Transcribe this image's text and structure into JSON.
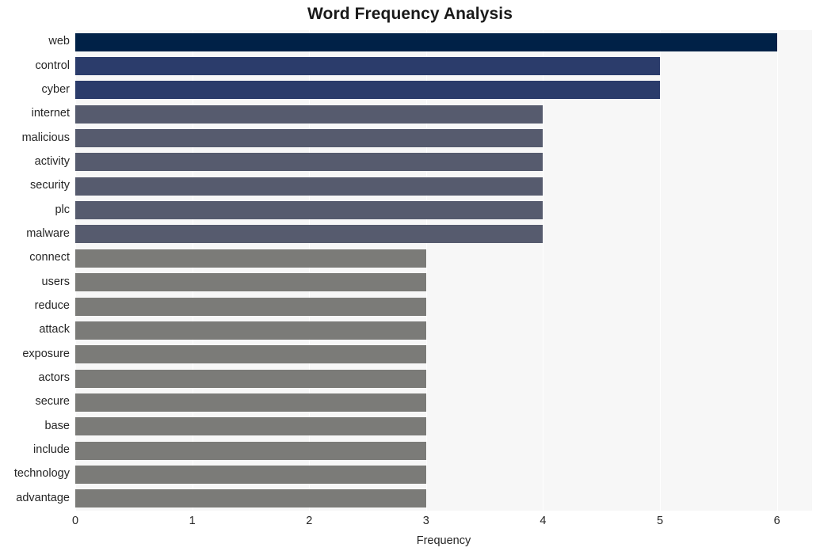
{
  "chart_data": {
    "type": "bar",
    "orientation": "horizontal",
    "title": "Word Frequency Analysis",
    "xlabel": "Frequency",
    "ylabel": "",
    "xlim": [
      0,
      6.3
    ],
    "xticks": [
      0,
      1,
      2,
      3,
      4,
      5,
      6
    ],
    "xtick_labels": [
      "0",
      "1",
      "2",
      "3",
      "4",
      "5",
      "6"
    ],
    "grid": true,
    "grid_axis": "x",
    "legend": false,
    "plot_background": "#f7f7f7",
    "figure_background": "#ffffff",
    "categories": [
      "web",
      "control",
      "cyber",
      "internet",
      "malicious",
      "activity",
      "security",
      "plc",
      "malware",
      "connect",
      "users",
      "reduce",
      "attack",
      "exposure",
      "actors",
      "secure",
      "base",
      "include",
      "technology",
      "advantage"
    ],
    "values": [
      6,
      5,
      5,
      4,
      4,
      4,
      4,
      4,
      4,
      3,
      3,
      3,
      3,
      3,
      3,
      3,
      3,
      3,
      3
    ],
    "bars": [
      {
        "label": "web",
        "value": 6,
        "color": "#002147"
      },
      {
        "label": "control",
        "value": 5,
        "color": "#2b3c6b"
      },
      {
        "label": "cyber",
        "value": 5,
        "color": "#2b3c6b"
      },
      {
        "label": "internet",
        "value": 4,
        "color": "#565b6e"
      },
      {
        "label": "malicious",
        "value": 4,
        "color": "#565b6e"
      },
      {
        "label": "activity",
        "value": 4,
        "color": "#565b6e"
      },
      {
        "label": "security",
        "value": 4,
        "color": "#565b6e"
      },
      {
        "label": "plc",
        "value": 4,
        "color": "#565b6e"
      },
      {
        "label": "malware",
        "value": 4,
        "color": "#565b6e"
      },
      {
        "label": "connect",
        "value": 3,
        "color": "#7b7b78"
      },
      {
        "label": "users",
        "value": 3,
        "color": "#7b7b78"
      },
      {
        "label": "reduce",
        "value": 3,
        "color": "#7b7b78"
      },
      {
        "label": "attack",
        "value": 3,
        "color": "#7b7b78"
      },
      {
        "label": "exposure",
        "value": 3,
        "color": "#7b7b78"
      },
      {
        "label": "actors",
        "value": 3,
        "color": "#7b7b78"
      },
      {
        "label": "secure",
        "value": 3,
        "color": "#7b7b78"
      },
      {
        "label": "base",
        "value": 3,
        "color": "#7b7b78"
      },
      {
        "label": "include",
        "value": 3,
        "color": "#7b7b78"
      },
      {
        "label": "technology",
        "value": 3,
        "color": "#7b7b78"
      },
      {
        "label": "advantage",
        "value": 3,
        "color": "#7b7b78"
      }
    ]
  }
}
